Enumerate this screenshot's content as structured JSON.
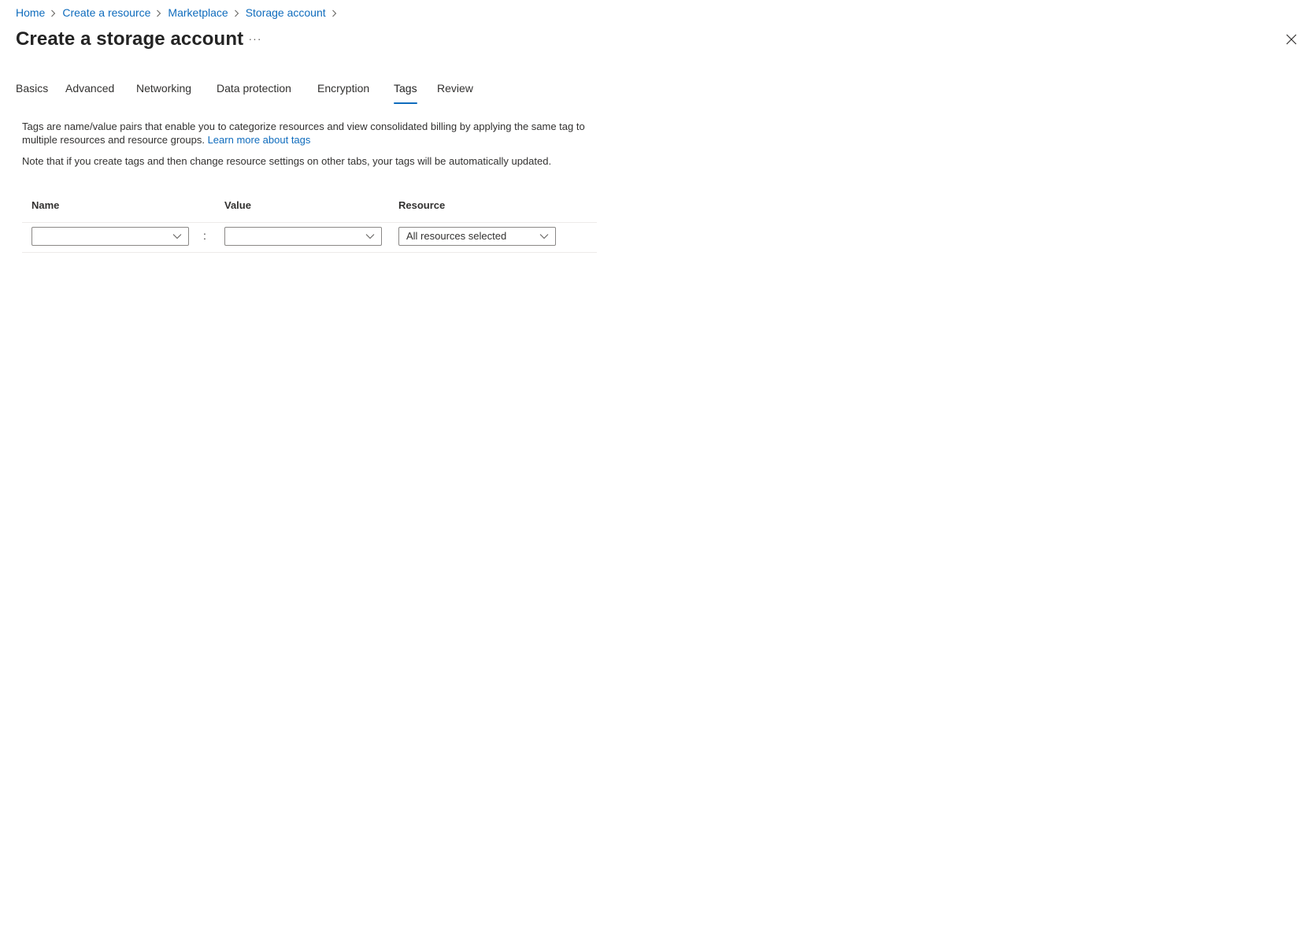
{
  "breadcrumb": {
    "items": [
      {
        "label": "Home"
      },
      {
        "label": "Create a resource"
      },
      {
        "label": "Marketplace"
      },
      {
        "label": "Storage account"
      }
    ]
  },
  "header": {
    "title": "Create a storage account",
    "more_label": "···"
  },
  "tabs": [
    {
      "label": "Basics"
    },
    {
      "label": "Advanced"
    },
    {
      "label": "Networking"
    },
    {
      "label": "Data protection"
    },
    {
      "label": "Encryption"
    },
    {
      "label": "Tags",
      "active": true
    },
    {
      "label": "Review"
    }
  ],
  "main": {
    "description_text": "Tags are name/value pairs that enable you to categorize resources and view consolidated billing by applying the same tag to multiple resources and resource groups.",
    "learn_more_link": "Learn more about tags",
    "note_text": "Note that if you create tags and then change resource settings on other tabs, your tags will be automatically updated.",
    "table": {
      "columns": [
        "Name",
        "Value",
        "Resource"
      ],
      "rows": [
        {
          "name": "",
          "separator": ":",
          "value": "",
          "resource": "All resources selected"
        }
      ]
    }
  },
  "colors": {
    "accent": "#0f6cbd",
    "text": "#323130",
    "border": "#8a8886",
    "divider": "#edebe9"
  },
  "icons": {
    "breadcrumb_separator": "chevron-right-icon",
    "close": "close-icon",
    "dropdown": "chevron-down-icon"
  }
}
